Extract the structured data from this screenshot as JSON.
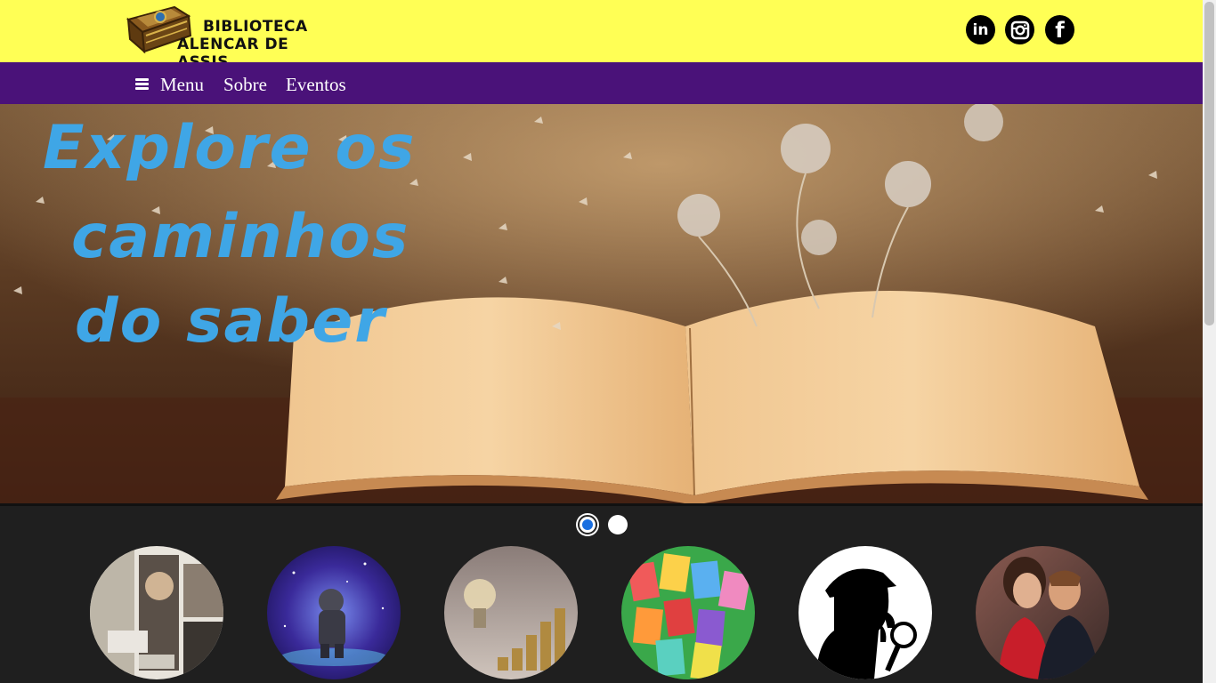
{
  "header": {
    "logo_line1": "BIBLIOTECA",
    "logo_line2": "ALENCAR DE ASSIS",
    "social": [
      {
        "name": "linkedin",
        "label": "in"
      },
      {
        "name": "instagram",
        "label": ""
      },
      {
        "name": "facebook",
        "label": "f"
      }
    ]
  },
  "nav": {
    "menu_label": "Menu",
    "items": [
      "Sobre",
      "Eventos"
    ]
  },
  "hero": {
    "line1": "Explore os",
    "line2": "caminhos",
    "line3": "do saber"
  },
  "carousel": {
    "slides_count": 2,
    "active_slide": 1
  },
  "categories": [
    {
      "icon": "history-collage-thumbnail"
    },
    {
      "icon": "astronaut-space-thumbnail"
    },
    {
      "icon": "lightbulb-coins-thumbnail"
    },
    {
      "icon": "children-books-thumbnail"
    },
    {
      "icon": "detective-silhouette-thumbnail"
    },
    {
      "icon": "romance-couple-thumbnail"
    }
  ],
  "colors": {
    "header_bg": "#ffff55",
    "nav_bg": "#4a1279",
    "hero_text": "#3fa6e6",
    "page_bg": "#1f1f1f",
    "active_dot": "#1a6fe0"
  }
}
